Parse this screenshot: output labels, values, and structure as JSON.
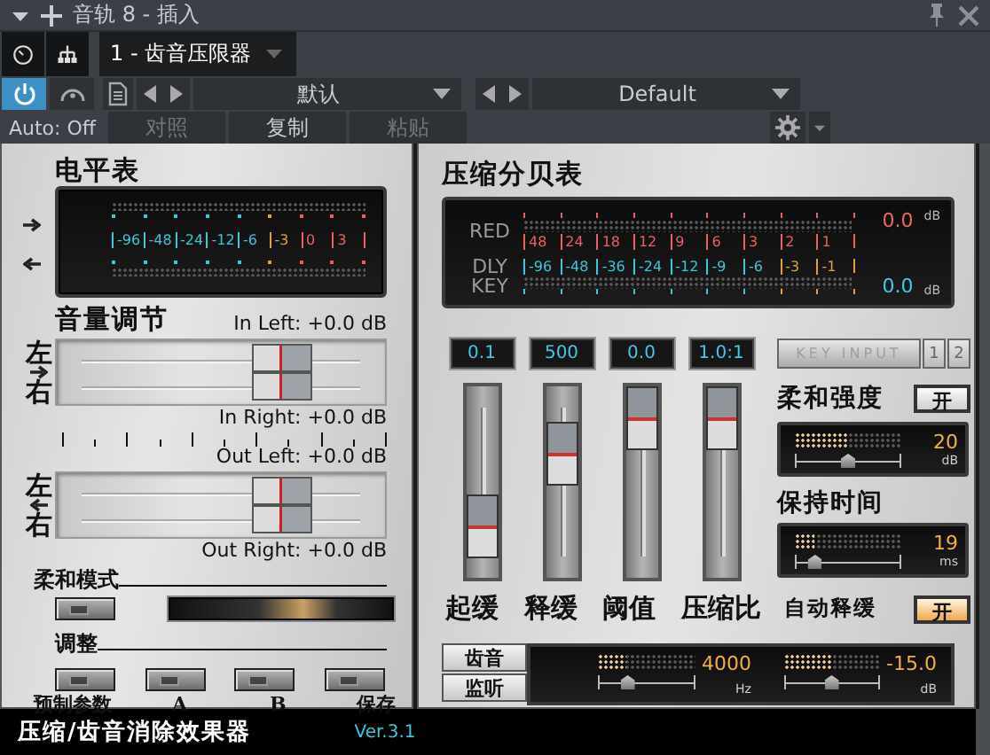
{
  "header": {
    "title": "音轨 8 - 插入",
    "insert": "1 - 齿音压限器"
  },
  "toolbar": {
    "power_on": true,
    "auto": "Auto: Off",
    "preset": "默认",
    "preset_default": "Default",
    "actions": [
      {
        "label": "对照",
        "disabled": true
      },
      {
        "label": "复制",
        "disabled": false
      },
      {
        "label": "粘贴",
        "disabled": true
      }
    ]
  },
  "level_panel": {
    "title": "电平表",
    "scale": [
      {
        "label": "-96",
        "color": "#38c8d8"
      },
      {
        "label": "-48",
        "color": "#38c8d8"
      },
      {
        "label": "-24",
        "color": "#38c8d8"
      },
      {
        "label": "-12",
        "color": "#38c8d8"
      },
      {
        "label": "-6",
        "color": "#38c8d8"
      },
      {
        "label": "-3",
        "color": "#e0a040"
      },
      {
        "label": "0",
        "color": "#e86060"
      },
      {
        "label": "3",
        "color": "#e86060"
      }
    ],
    "volume_title": "音量调节",
    "faders": [
      {
        "kind": "input",
        "top": "左",
        "bottom": "右",
        "label_top": "In Left: +0.0 dB",
        "label_bottom": "In Right: +0.0 dB",
        "level": 0.73
      },
      {
        "kind": "output",
        "top": "左",
        "bottom": "右",
        "label_top": "Out Left: +0.0 dB",
        "label_bottom": "Out Right: +0.0 dB",
        "level": 0.73
      }
    ],
    "soft_mode": {
      "title": "柔和模式",
      "on": false
    },
    "adjust": {
      "title": "调整",
      "buttons": [
        "预制参数",
        "A",
        "B",
        "保存"
      ]
    }
  },
  "comp_panel": {
    "title": "压缩分贝表",
    "red": {
      "label": "RED",
      "reading": "0.0",
      "unit": "dB",
      "scale": [
        {
          "label": "48",
          "color": "#e86060"
        },
        {
          "label": "24",
          "color": "#e86060"
        },
        {
          "label": "18",
          "color": "#e86060"
        },
        {
          "label": "12",
          "color": "#e86060"
        },
        {
          "label": "9",
          "color": "#e86060"
        },
        {
          "label": "6",
          "color": "#e86060"
        },
        {
          "label": "3",
          "color": "#e86060"
        },
        {
          "label": "2",
          "color": "#e86060"
        },
        {
          "label": "1",
          "color": "#e86060"
        }
      ]
    },
    "key": {
      "label_top": "DLY",
      "label_bottom": "KEY",
      "reading": "0.0",
      "unit": "dB",
      "scale": [
        {
          "label": "-96",
          "color": "#38c8d8"
        },
        {
          "label": "-48",
          "color": "#38c8d8"
        },
        {
          "label": "-36",
          "color": "#38c8d8"
        },
        {
          "label": "-24",
          "color": "#38c8d8"
        },
        {
          "label": "-12",
          "color": "#38c8d8"
        },
        {
          "label": "-9",
          "color": "#38c8d8"
        },
        {
          "label": "-6",
          "color": "#38c8d8"
        },
        {
          "label": "-3",
          "color": "#e0a040"
        },
        {
          "label": "-1",
          "color": "#e0a040"
        }
      ]
    },
    "faders": [
      {
        "value": "0.1",
        "label": "起缓",
        "level": 0.15
      },
      {
        "value": "500",
        "label": "释缓",
        "level": 0.72
      },
      {
        "value": "0.0",
        "label": "阈值",
        "level": 1
      },
      {
        "value": "1.0:1",
        "label": "压缩比",
        "level": 1
      }
    ],
    "key_input": {
      "label": "KEY INPUT",
      "channels": [
        "1",
        "2"
      ],
      "disabled": true
    },
    "soft_strength": {
      "title": "柔和强度",
      "toggle": "开",
      "on": false,
      "value": "20",
      "unit": "dB",
      "level": 0.5
    },
    "hold_time": {
      "title": "保持时间",
      "value": "19",
      "unit": "ms",
      "level": 0.18
    },
    "auto_release": {
      "title": "自动释缓",
      "toggle": "开",
      "on": true
    },
    "deesser": {
      "buttons": [
        "齿音",
        "监听"
      ],
      "freq": {
        "value": "4000",
        "unit": "Hz",
        "level": 0.3
      },
      "gain": {
        "value": "-15.0",
        "unit": "dB",
        "level": 0.5
      }
    }
  },
  "footer": {
    "title": "压缩/齿音消除效果器",
    "version": "Ver.3.1"
  }
}
